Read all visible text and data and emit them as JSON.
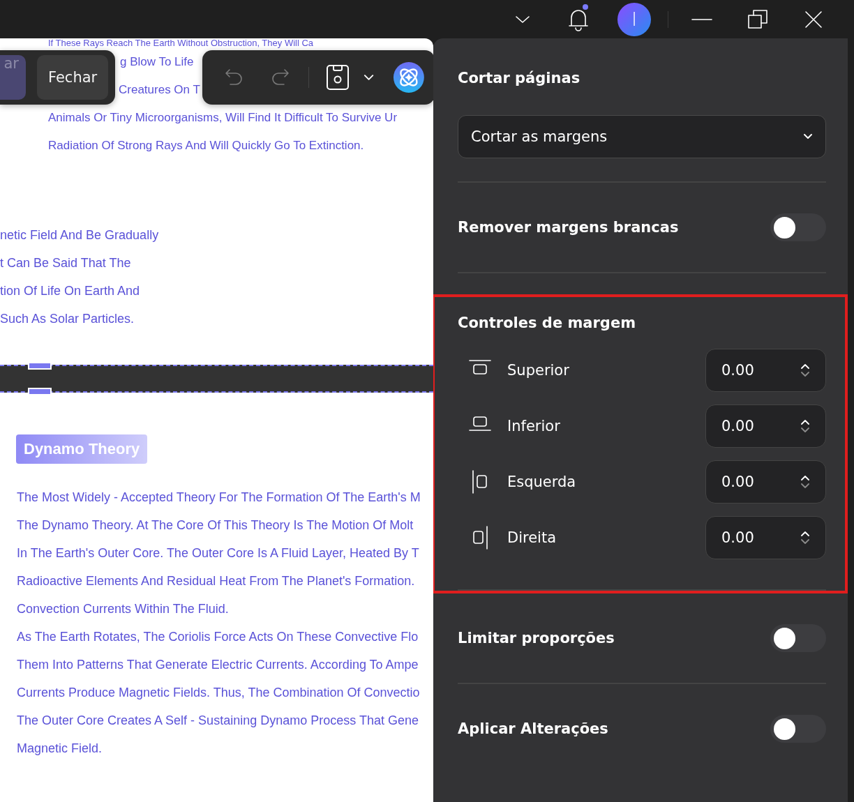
{
  "title_bar": {
    "avatar_letter": "I",
    "notification_dot": true
  },
  "left_toolbar": {
    "buttons": [
      {
        "label": "ar",
        "kind": "primary"
      },
      {
        "label": "Fechar",
        "kind": "secondary"
      }
    ]
  },
  "edit_toolbar": {
    "undo_disabled": true,
    "redo_disabled": true
  },
  "document": {
    "top_lines": [
      {
        "kind": "full",
        "parts": [
          "If These Rays Reach The Earth Without Obstruction, They Will Ca"
        ]
      },
      {
        "kind": "behind",
        "parts": [
          "g Blow To Life"
        ]
      },
      {
        "kind": "behind",
        "parts": [
          "Creatures On T"
        ]
      },
      {
        "kind": "full",
        "parts": [
          "Animals Or Tiny Microorganisms, Will Find It Difficult To Survive Ur"
        ]
      },
      {
        "kind": "full",
        "parts": [
          "Radiation Of Strong Rays And Will Quickly Go To Extinction."
        ]
      }
    ],
    "cut_lines": [
      "netic Field And Be Gradually",
      "t Can Be Said That The",
      "tion Of Life On Earth And",
      "Such As Solar Particles."
    ],
    "heading": "Dynamo Theory",
    "paragraph": [
      "The Most Widely - Accepted Theory For The Formation Of The Earth's M",
      "The Dynamo Theory. At The Core Of This Theory Is The Motion Of Molt",
      "In The Earth's Outer Core. The Outer Core Is A Fluid Layer, Heated By T",
      "Radioactive Elements And Residual Heat From The Planet's Formation.",
      "Convection Currents Within The Fluid.",
      "As The Earth Rotates, The Coriolis Force Acts On These Convective Flo",
      "Them Into Patterns That Generate Electric Currents. According To Ampe",
      "Currents Produce Magnetic Fields. Thus, The Combination Of Convectio",
      "The Outer Core Creates A Self - Sustaining Dynamo Process That Gene",
      "Magnetic Field."
    ]
  },
  "panel": {
    "title": "Cortar páginas",
    "mode_select": {
      "value": "Cortar as margens"
    },
    "remove_white_margins": {
      "label": "Remover margens brancas",
      "on": false
    },
    "margin_controls": {
      "title": "Controles de margem",
      "highlighted": true,
      "rows": [
        {
          "kind": "top",
          "label": "Superior",
          "value": "0.00"
        },
        {
          "kind": "bottom",
          "label": "Inferior",
          "value": "0.00"
        },
        {
          "kind": "left",
          "label": "Esquerda",
          "value": "0.00"
        },
        {
          "kind": "right",
          "label": "Direita",
          "value": "0.00"
        }
      ]
    },
    "lock_ratio": {
      "label": "Limitar proporções",
      "on": false
    },
    "apply_changes": {
      "label": "Aplicar Alterações",
      "on": false
    }
  }
}
